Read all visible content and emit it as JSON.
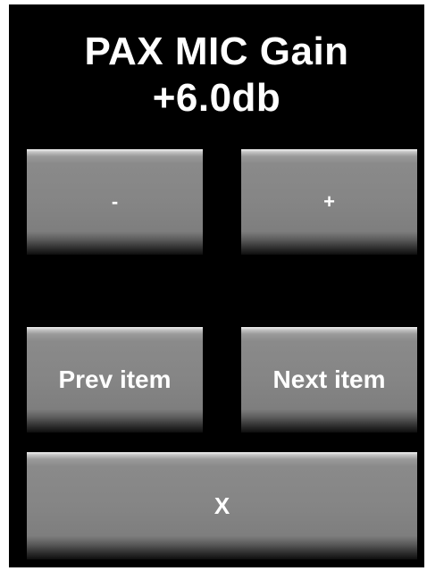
{
  "header": {
    "title": "PAX MIC Gain",
    "value": "+6.0db"
  },
  "buttons": {
    "decrease": "-",
    "increase": "+",
    "prev_item": "Prev item",
    "next_item": "Next item",
    "close": "X"
  },
  "colors": {
    "background": "#000000",
    "button_face": "#858585",
    "text": "#ffffff"
  }
}
